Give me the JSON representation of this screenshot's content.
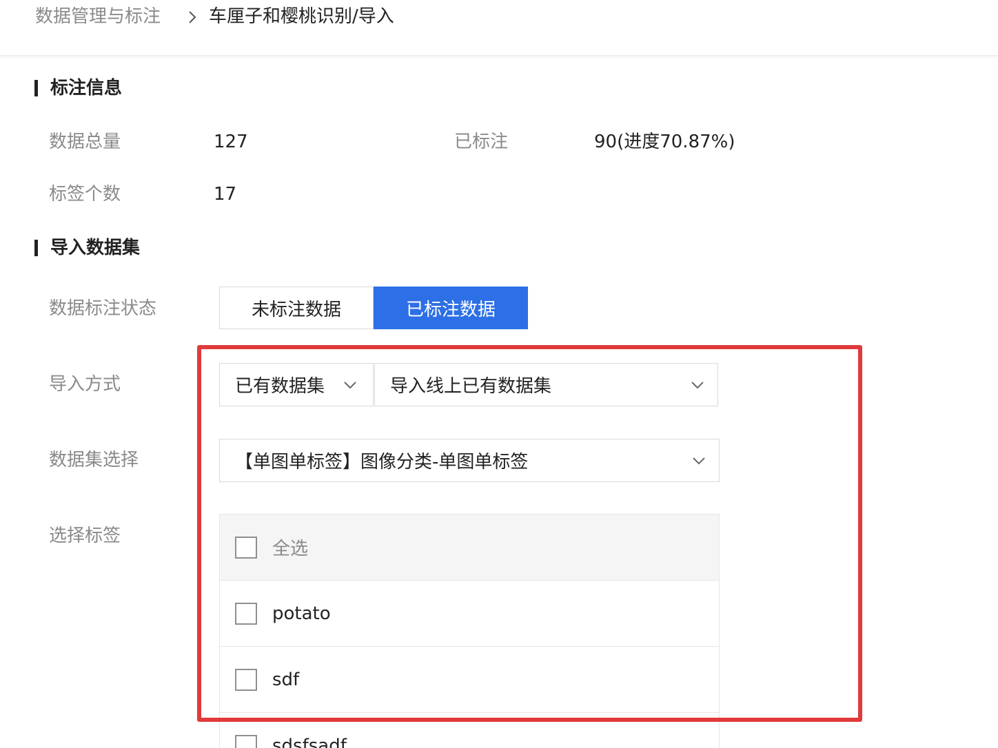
{
  "breadcrumb": {
    "root": "数据管理与标注",
    "current": "车厘子和樱桃识别/导入"
  },
  "annotation_info": {
    "title": "标注信息",
    "total_label": "数据总量",
    "total_value": "127",
    "labeled_label": "已标注",
    "labeled_value": "90(进度70.87%)",
    "tag_count_label": "标签个数",
    "tag_count_value": "17"
  },
  "import_dataset": {
    "title": "导入数据集",
    "status_label": "数据标注状态",
    "status_options": [
      "未标注数据",
      "已标注数据"
    ],
    "status_selected": "已标注数据",
    "method_label": "导入方式",
    "method_type": "已有数据集",
    "method_source": "导入线上已有数据集",
    "dataset_label": "数据集选择",
    "dataset_value": "【单图单标签】图像分类-单图单标签",
    "tags_label": "选择标签",
    "tags": {
      "select_all": "全选",
      "items": [
        "potato",
        "sdf",
        "sdsfsadf"
      ]
    }
  },
  "colors": {
    "accent": "#2d6fe6",
    "highlight_border": "#e03a3a"
  }
}
